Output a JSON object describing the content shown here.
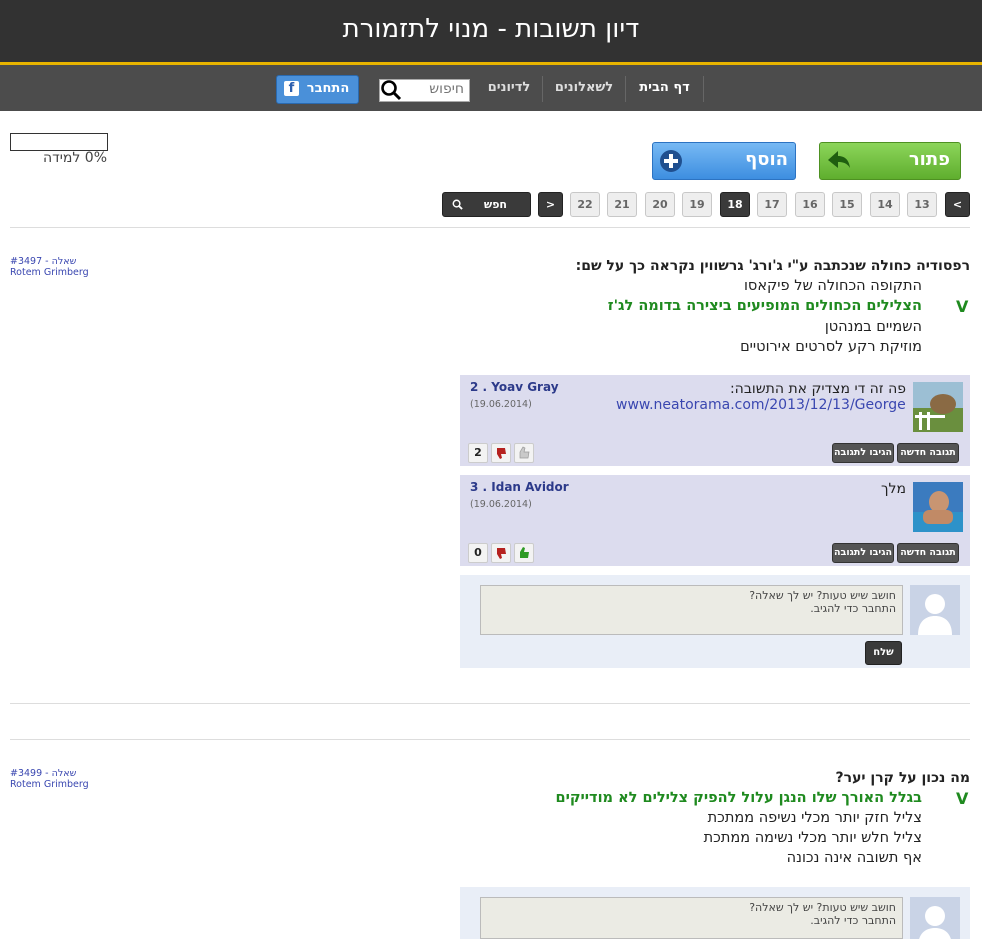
{
  "header": {
    "title": "דיון תשובות - מנוי לתזמורת"
  },
  "nav": {
    "home": "דף הבית",
    "quizzes": "לשאלונים",
    "discussions": "לדיונים",
    "search_placeholder": "חיפוש",
    "facebook_label": "התחבר",
    "facebook_icon": "f"
  },
  "progress": {
    "text": "0% למידה",
    "fraction": 0
  },
  "actions": {
    "solve_label": "פתור אותי!",
    "add_label": "הוסף שאלה"
  },
  "pagination": {
    "prev": "<",
    "next": ">",
    "pages": [
      "13",
      "14",
      "15",
      "16",
      "17",
      "18",
      "19",
      "20",
      "21",
      "22"
    ],
    "current": "18",
    "find_label": "חפש שאלה"
  },
  "questions": [
    {
      "meta_line1": "#3497 - שאלה",
      "meta_line2": "Rotem Grimberg",
      "title": "רפסודיה כחולה שנכתבה ע\"י ג'ורג' גרשווין נקראה כך על שם:",
      "answers": [
        {
          "text": "התקופה הכחולה של פיקאסו",
          "correct": false
        },
        {
          "text": "הצלילים הכחולים המופיעים ביצירה בדומה לג'ז",
          "correct": true
        },
        {
          "text": "השמיים במנהטן",
          "correct": false
        },
        {
          "text": "מוזיקת רקע לסרטים אירוטיים",
          "correct": false
        }
      ],
      "check_mark": "V",
      "comments": [
        {
          "name": "2 . Yoav Gray",
          "date": "(19.06.2014)",
          "text": "פה זה די מצדיק את התשובה:",
          "link": "www.neatorama.com/2013/12/13/George-G...",
          "new_reply": "תגובה חדשה",
          "quote_reply": "הגיבו לתגובה",
          "score": "2"
        },
        {
          "name": "3 . Idan Avidor",
          "date": "(19.06.2014)",
          "text": "מלך",
          "new_reply": "תגובה חדשה",
          "quote_reply": "הגיבו לתגובה",
          "score": "0"
        }
      ],
      "reply": {
        "placeholder_line1": "חושב שיש טעות? יש לך שאלה?",
        "placeholder_line2": "התחבר כדי להגיב.",
        "send": "שלח"
      }
    },
    {
      "meta_line1": "#3499 - שאלה",
      "meta_line2": "Rotem Grimberg",
      "title": "מה נכון על קרן יער?",
      "answers": [
        {
          "text": "בגלל האורך שלו הנגן עלול להפיק צלילים לא מודייקים",
          "correct": true
        },
        {
          "text": "צליל חזק יותר מכלי נשיפה ממתכת",
          "correct": false
        },
        {
          "text": "צליל חלש יותר מכלי נשימה ממתכת",
          "correct": false
        },
        {
          "text": "אף תשובה אינה נכונה",
          "correct": false
        }
      ],
      "check_mark": "V",
      "reply": {
        "placeholder_line1": "חושב שיש טעות? יש לך שאלה?",
        "placeholder_line2": "התחבר כדי להגיב."
      }
    }
  ]
}
